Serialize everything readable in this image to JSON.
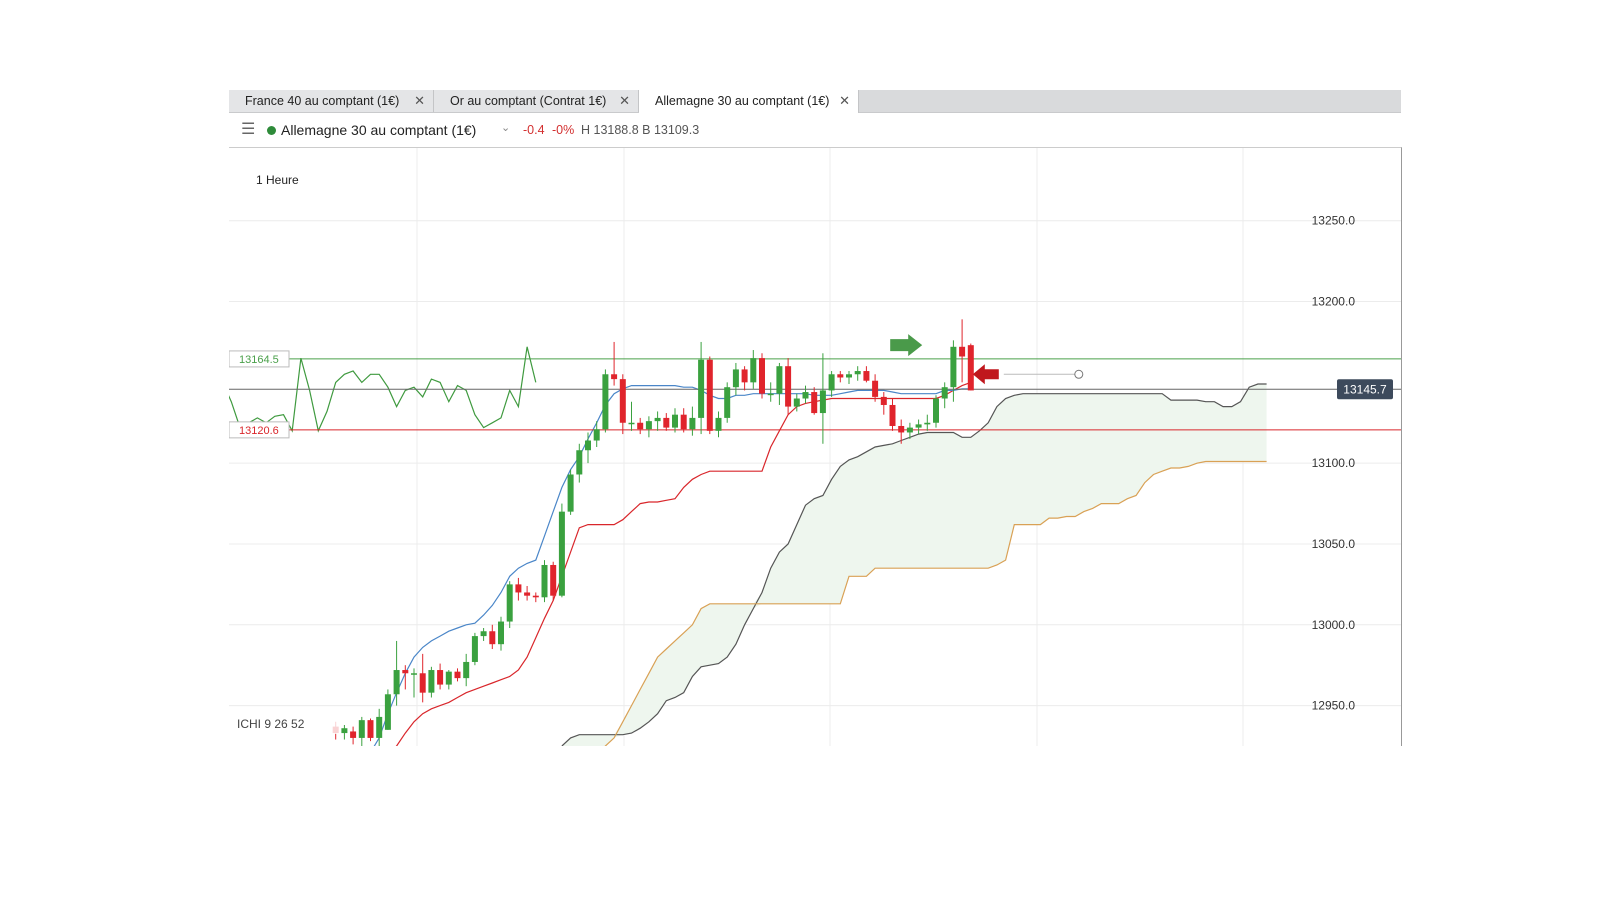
{
  "tabs": [
    {
      "label": "France 40 au comptant (1€)",
      "close": "✕"
    },
    {
      "label": "Or au comptant (Contrat 1€)",
      "close": "✕"
    },
    {
      "label": "Allemagne 30 au comptant (1€)",
      "close": "✕"
    }
  ],
  "header": {
    "menu_icon": "☰",
    "instrument": "Allemagne 30 au comptant (1€)",
    "dropdown_icon": "⌄",
    "change": "-0.4",
    "change_pct": "-0%",
    "high_low": "H 13188.8 B 13109.3"
  },
  "colors": {
    "up": "#3aa13f",
    "down": "#e0242c",
    "tenkan": "#4a86c8",
    "kijun": "#d9262b",
    "chikou": "#3f9a3f",
    "spanA": "#555555",
    "spanB": "#d9a155",
    "cloud": "#eef6ee",
    "resistance": "#4aa04a",
    "support": "#d9262b",
    "price_badge": "#3d4a5c"
  },
  "chart_data": {
    "type": "candlestick",
    "timeframe": "1 Heure",
    "y_ticks": [
      "13250.0",
      "13200.0",
      "13100.0",
      "13050.0",
      "13000.0",
      "12950.0"
    ],
    "ylim": [
      12925,
      13295
    ],
    "current_price": "13145.7",
    "levels": [
      {
        "label": "13164.5",
        "value": 13164.5,
        "color": "#4aa04a"
      },
      {
        "label": "13120.6",
        "value": 13120.6,
        "color": "#d9262b"
      }
    ],
    "indicator_label": "ICHI 9 26 52",
    "annotations": [
      {
        "icon": "green-arrow-icon",
        "value": 13173
      },
      {
        "icon": "red-arrow-icon",
        "value": 13155
      }
    ],
    "candles": [
      [
        12937,
        12940,
        12929,
        12933
      ],
      [
        12933,
        12938,
        12929,
        12936
      ],
      [
        12934,
        12937,
        12926,
        12930
      ],
      [
        12930,
        12943,
        12920,
        12941
      ],
      [
        12941,
        12942,
        12928,
        12930
      ],
      [
        12930,
        12948,
        12920,
        12943
      ],
      [
        12935,
        12960,
        12935,
        12957
      ],
      [
        12957,
        12990,
        12950,
        12972
      ],
      [
        12972,
        12975,
        12960,
        12970
      ],
      [
        12970,
        12973,
        12955,
        12970
      ],
      [
        12970,
        12982,
        12952,
        12958
      ],
      [
        12958,
        12974,
        12955,
        12972
      ],
      [
        12972,
        12976,
        12960,
        12963
      ],
      [
        12963,
        12972,
        12960,
        12971
      ],
      [
        12971,
        12973,
        12965,
        12967
      ],
      [
        12967,
        12982,
        12962,
        12977
      ],
      [
        12977,
        12995,
        12975,
        12993
      ],
      [
        12993,
        12998,
        12990,
        12996
      ],
      [
        12996,
        13000,
        12985,
        12988
      ],
      [
        12988,
        13005,
        12984,
        13002
      ],
      [
        13002,
        13027,
        12998,
        13025
      ],
      [
        13025,
        13029,
        13015,
        13020
      ],
      [
        13020,
        13024,
        13015,
        13018
      ],
      [
        13018,
        13020,
        13014,
        13017
      ],
      [
        13017,
        13040,
        13014,
        13037
      ],
      [
        13037,
        13039,
        13015,
        13018
      ],
      [
        13018,
        13075,
        13017,
        13070
      ],
      [
        13070,
        13096,
        13068,
        13093
      ],
      [
        13093,
        13112,
        13088,
        13108
      ],
      [
        13108,
        13119,
        13100,
        13114
      ],
      [
        13114,
        13126,
        13110,
        13121
      ],
      [
        13121,
        13158,
        13119,
        13155
      ],
      [
        13155,
        13175,
        13148,
        13152
      ],
      [
        13152,
        13155,
        13118,
        13125
      ],
      [
        13125,
        13138,
        13120,
        13125
      ],
      [
        13125,
        13128,
        13118,
        13121
      ],
      [
        13121,
        13129,
        13116,
        13126
      ],
      [
        13126,
        13132,
        13120,
        13128
      ],
      [
        13128,
        13131,
        13120,
        13122
      ],
      [
        13122,
        13134,
        13119,
        13130
      ],
      [
        13130,
        13134,
        13119,
        13121
      ],
      [
        13121,
        13135,
        13117,
        13128
      ],
      [
        13128,
        13175,
        13118,
        13164
      ],
      [
        13164,
        13166,
        13118,
        13120
      ],
      [
        13120,
        13132,
        13116,
        13128
      ],
      [
        13128,
        13150,
        13125,
        13147
      ],
      [
        13147,
        13162,
        13142,
        13158
      ],
      [
        13158,
        13160,
        13145,
        13150
      ],
      [
        13150,
        13170,
        13146,
        13165
      ],
      [
        13165,
        13168,
        13140,
        13143
      ],
      [
        13143,
        13150,
        13138,
        13143
      ],
      [
        13143,
        13162,
        13136,
        13160
      ],
      [
        13160,
        13165,
        13130,
        13135
      ],
      [
        13135,
        13143,
        13132,
        13140
      ],
      [
        13140,
        13148,
        13137,
        13144
      ],
      [
        13144,
        13147,
        13130,
        13131
      ],
      [
        13131,
        13168,
        13112,
        13145
      ],
      [
        13145,
        13157,
        13141,
        13155
      ],
      [
        13155,
        13157,
        13150,
        13153
      ],
      [
        13153,
        13157,
        13149,
        13155
      ],
      [
        13155,
        13160,
        13151,
        13157
      ],
      [
        13157,
        13160,
        13150,
        13151
      ],
      [
        13151,
        13155,
        13138,
        13141
      ],
      [
        13141,
        13144,
        13130,
        13136
      ],
      [
        13136,
        13140,
        13120,
        13123
      ],
      [
        13123,
        13127,
        13112,
        13119
      ],
      [
        13119,
        13125,
        13115,
        13122
      ],
      [
        13122,
        13127,
        13118,
        13124
      ],
      [
        13124,
        13130,
        13120,
        13125
      ],
      [
        13125,
        13142,
        13122,
        13140
      ],
      [
        13140,
        13150,
        13134,
        13147
      ],
      [
        13147,
        13176,
        13138,
        13172
      ],
      [
        13172,
        13189,
        13150,
        13166
      ],
      [
        13173,
        13174,
        13145,
        13145
      ]
    ],
    "tenkan": [
      12905,
      12907,
      12910,
      12915,
      12921,
      12930,
      12945,
      12958,
      12970,
      12980,
      12986,
      12990,
      12993,
      12996,
      12998,
      13000,
      13001,
      13006,
      13012,
      13020,
      13030,
      13035,
      13038,
      13040,
      13055,
      13070,
      13085,
      13096,
      13104,
      13115,
      13125,
      13136,
      13143,
      13146,
      13148,
      13148,
      13148,
      13148,
      13148,
      13148,
      13147,
      13147,
      13145,
      13142,
      13140,
      13140,
      13142,
      13142,
      13143,
      13143,
      13143,
      13143,
      13143,
      13143,
      13143,
      13142,
      13142,
      13142,
      13143,
      13144,
      13145,
      13145,
      13145,
      13145,
      13144,
      13143,
      13143,
      13143,
      13143,
      13143,
      13145,
      13145,
      13146,
      13146
    ],
    "kijun": [
      12890,
      12895,
      12900,
      12905,
      12910,
      12915,
      12920,
      12925,
      12933,
      12940,
      12945,
      12948,
      12950,
      12952,
      12955,
      12958,
      12960,
      12962,
      12964,
      12966,
      12968,
      12972,
      12980,
      12992,
      13004,
      13015,
      13030,
      13045,
      13060,
      13062,
      13062,
      13062,
      13062,
      13065,
      13070,
      13075,
      13076,
      13076,
      13077,
      13078,
      13085,
      13090,
      13093,
      13095,
      13095,
      13095,
      13095,
      13095,
      13095,
      13095,
      13110,
      13120,
      13130,
      13135,
      13137,
      13138,
      13139,
      13140,
      13140,
      13140,
      13140,
      13140,
      13140,
      13140,
      13140,
      13140,
      13140,
      13140,
      13140,
      13140,
      13142,
      13145,
      13148,
      13150
    ],
    "chikou": [
      13019,
      13018,
      13037,
      13065,
      13095,
      13105,
      13111,
      13120,
      13145,
      13150,
      13138,
      13122,
      13125,
      13128,
      13125,
      13129,
      13130,
      13120,
      13165,
      13145,
      13120,
      13132,
      13150,
      13155,
      13157,
      13150,
      13155,
      13155,
      13147,
      13135,
      13145,
      13147,
      13141,
      13152,
      13150,
      13138,
      13148,
      13145,
      13130,
      13122,
      13125,
      13128,
      13145,
      13135,
      13172,
      13150
    ],
    "spanA": [
      12925,
      12930,
      12932,
      12932,
      12932,
      12932,
      12932,
      12932,
      12933,
      12936,
      12940,
      12945,
      12953,
      12955,
      12958,
      12968,
      12974,
      12975,
      12976,
      12980,
      12988,
      13000,
      13010,
      13020,
      13035,
      13045,
      13050,
      13062,
      13074,
      13078,
      13080,
      13090,
      13098,
      13102,
      13104,
      13107,
      13110,
      13111,
      13112,
      13114,
      13116,
      13118,
      13119,
      13119,
      13119,
      13119,
      13116,
      13116,
      13120,
      13125,
      13135,
      13140,
      13142,
      13143,
      13143,
      13143,
      13143,
      13143,
      13143,
      13143,
      13143,
      13143,
      13143,
      13143,
      13143,
      13143,
      13143,
      13143,
      13143,
      13143,
      13139,
      13139,
      13139,
      13139,
      13138,
      13138,
      13135,
      13135,
      13138,
      13147,
      13149,
      13149
    ],
    "spanB": [
      12880,
      12890,
      12900,
      12910,
      12920,
      12925,
      12930,
      12940,
      12950,
      12960,
      12970,
      12980,
      12985,
      12990,
      12995,
      13000,
      13010,
      13013,
      13013,
      13013,
      13013,
      13013,
      13013,
      13013,
      13013,
      13013,
      13013,
      13013,
      13013,
      13013,
      13013,
      13013,
      13013,
      13030,
      13030,
      13030,
      13035,
      13035,
      13035,
      13035,
      13035,
      13035,
      13035,
      13035,
      13035,
      13035,
      13035,
      13035,
      13035,
      13035,
      13037,
      13040,
      13062,
      13062,
      13062,
      13062,
      13066,
      13066,
      13067,
      13067,
      13070,
      13072,
      13075,
      13075,
      13075,
      13078,
      13080,
      13088,
      13093,
      13095,
      13097,
      13097,
      13098,
      13100,
      13101,
      13101,
      13101,
      13101,
      13101,
      13101,
      13101,
      13101
    ]
  }
}
